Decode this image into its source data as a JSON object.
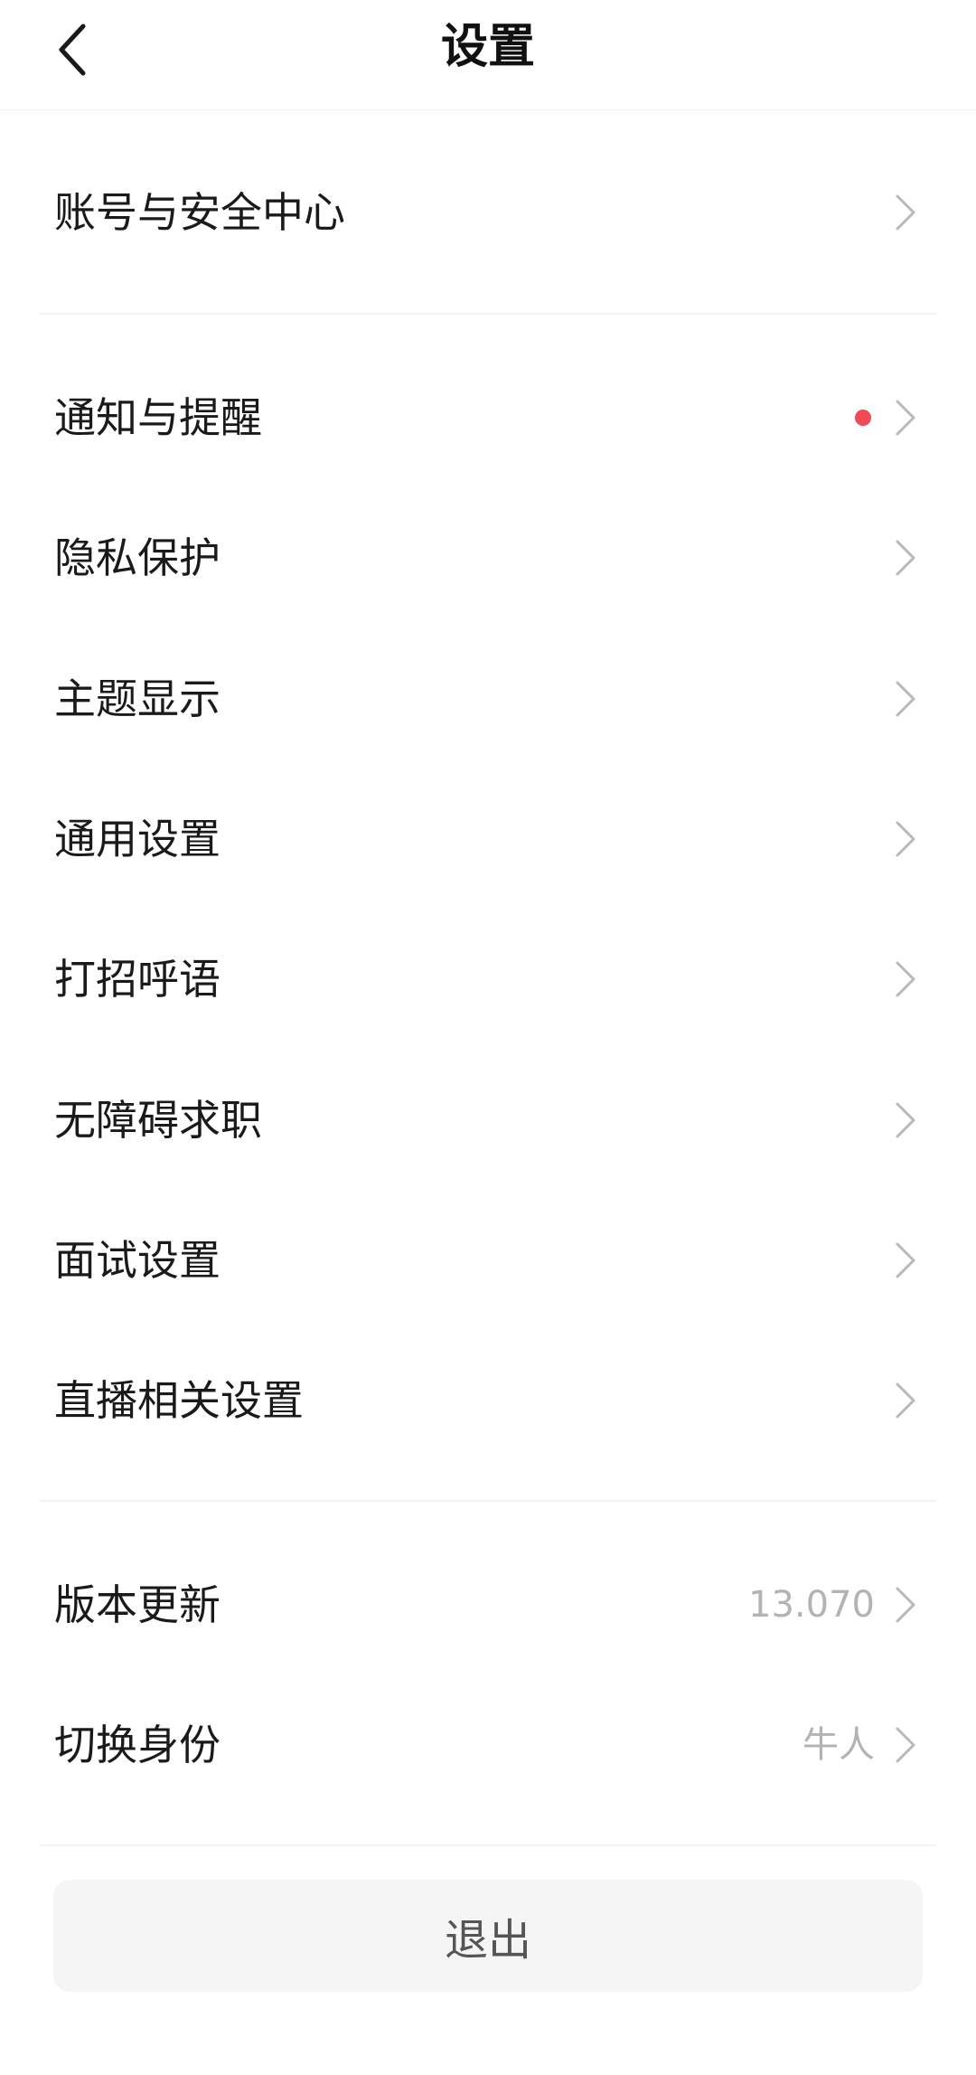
{
  "header": {
    "title": "设置",
    "back_icon": "chevron-left-icon"
  },
  "sections": {
    "account": {
      "label": "账号与安全中心"
    },
    "notifications": {
      "label": "通知与提醒",
      "badge_color": "#f04a55"
    },
    "privacy": {
      "label": "隐私保护"
    },
    "theme": {
      "label": "主题显示"
    },
    "general": {
      "label": "通用设置"
    },
    "greeting": {
      "label": "打招呼语"
    },
    "accessibility": {
      "label": "无障碍求职"
    },
    "interview": {
      "label": "面试设置"
    },
    "live": {
      "label": "直播相关设置"
    },
    "version": {
      "label": "版本更新",
      "value": "13.070"
    },
    "identity": {
      "label": "切换身份",
      "value": "牛人"
    }
  },
  "logout": {
    "label": "退出"
  },
  "icons": {
    "row_chevron": "chevron-right-icon"
  },
  "colors": {
    "text_primary": "#1a1a1a",
    "text_secondary": "#b3b3b3",
    "badge_red": "#f04a55",
    "logout_bg": "#f5f5f5"
  }
}
